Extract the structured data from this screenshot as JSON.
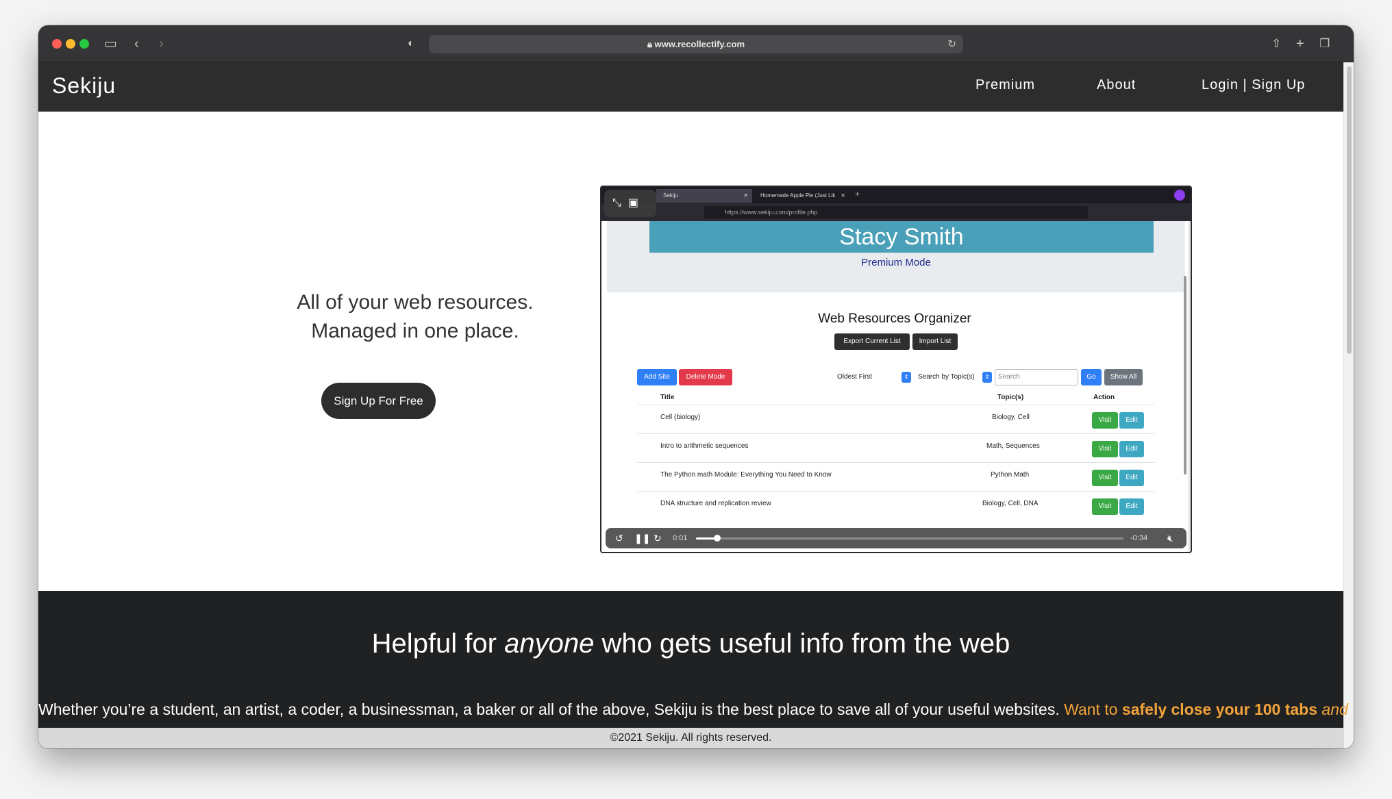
{
  "browser": {
    "url": "www.recollectify.com"
  },
  "site": {
    "brand": "Sekiju",
    "nav": [
      "Premium",
      "About",
      "Login | Sign Up"
    ]
  },
  "hero": {
    "line1": "All of your web resources.",
    "line2": "Managed in one place.",
    "cta": "Sign Up For Free"
  },
  "video": {
    "tabs": [
      "Sekiju",
      "Homemade Apple Pie (Just Lik"
    ],
    "url": "https://www.sekiju.com/profile.php",
    "user_name": "Stacy Smith",
    "mode": "Premium Mode",
    "heading": "Web Resources Organizer",
    "export_label": "Export Current List",
    "import_label": "Import List",
    "add_label": "Add Site",
    "delete_label": "Delete Mode",
    "sort_value": "Oldest First",
    "topic_value": "Search by Topic(s)",
    "search_placeholder": "Search",
    "go_label": "Go",
    "show_all_label": "Show All",
    "columns": [
      "Title",
      "Topic(s)",
      "Action"
    ],
    "rows": [
      {
        "title": "Cell (biology)",
        "topics": "Biology, Cell"
      },
      {
        "title": "Intro to arithmetic sequences",
        "topics": "Math, Sequences"
      },
      {
        "title": "The Python math Module: Everything You Need to Know",
        "topics": "Python Math"
      },
      {
        "title": "DNA structure and replication review",
        "topics": "Biology, Cell, DNA"
      }
    ],
    "visit_label": "Visit",
    "edit_label": "Edit",
    "elapsed": "0:01",
    "remaining": "-0:34",
    "progress": 0.05
  },
  "section": {
    "heading_pre": "Helpful for ",
    "heading_em": "anyone",
    "heading_post": " who gets useful info from the web",
    "para_main": "Whether you’re a student, an artist, a coder, a businessman, a baker or all of the above, Sekiju is the best place to save all of your useful websites.",
    "para_orange1": " Want to ",
    "para_bold": "safely close your 100 tabs",
    "para_em": " and"
  },
  "footer": "©2021 Sekiju. All rights reserved.",
  "colors": {
    "nav_bg": "#2d2d2e",
    "accent_orange": "#f2a33a",
    "visit_green": "#3aa845",
    "edit_teal": "#3ea8c2",
    "delete_red": "#e23a4a",
    "primary_blue": "#2f7ff7"
  }
}
